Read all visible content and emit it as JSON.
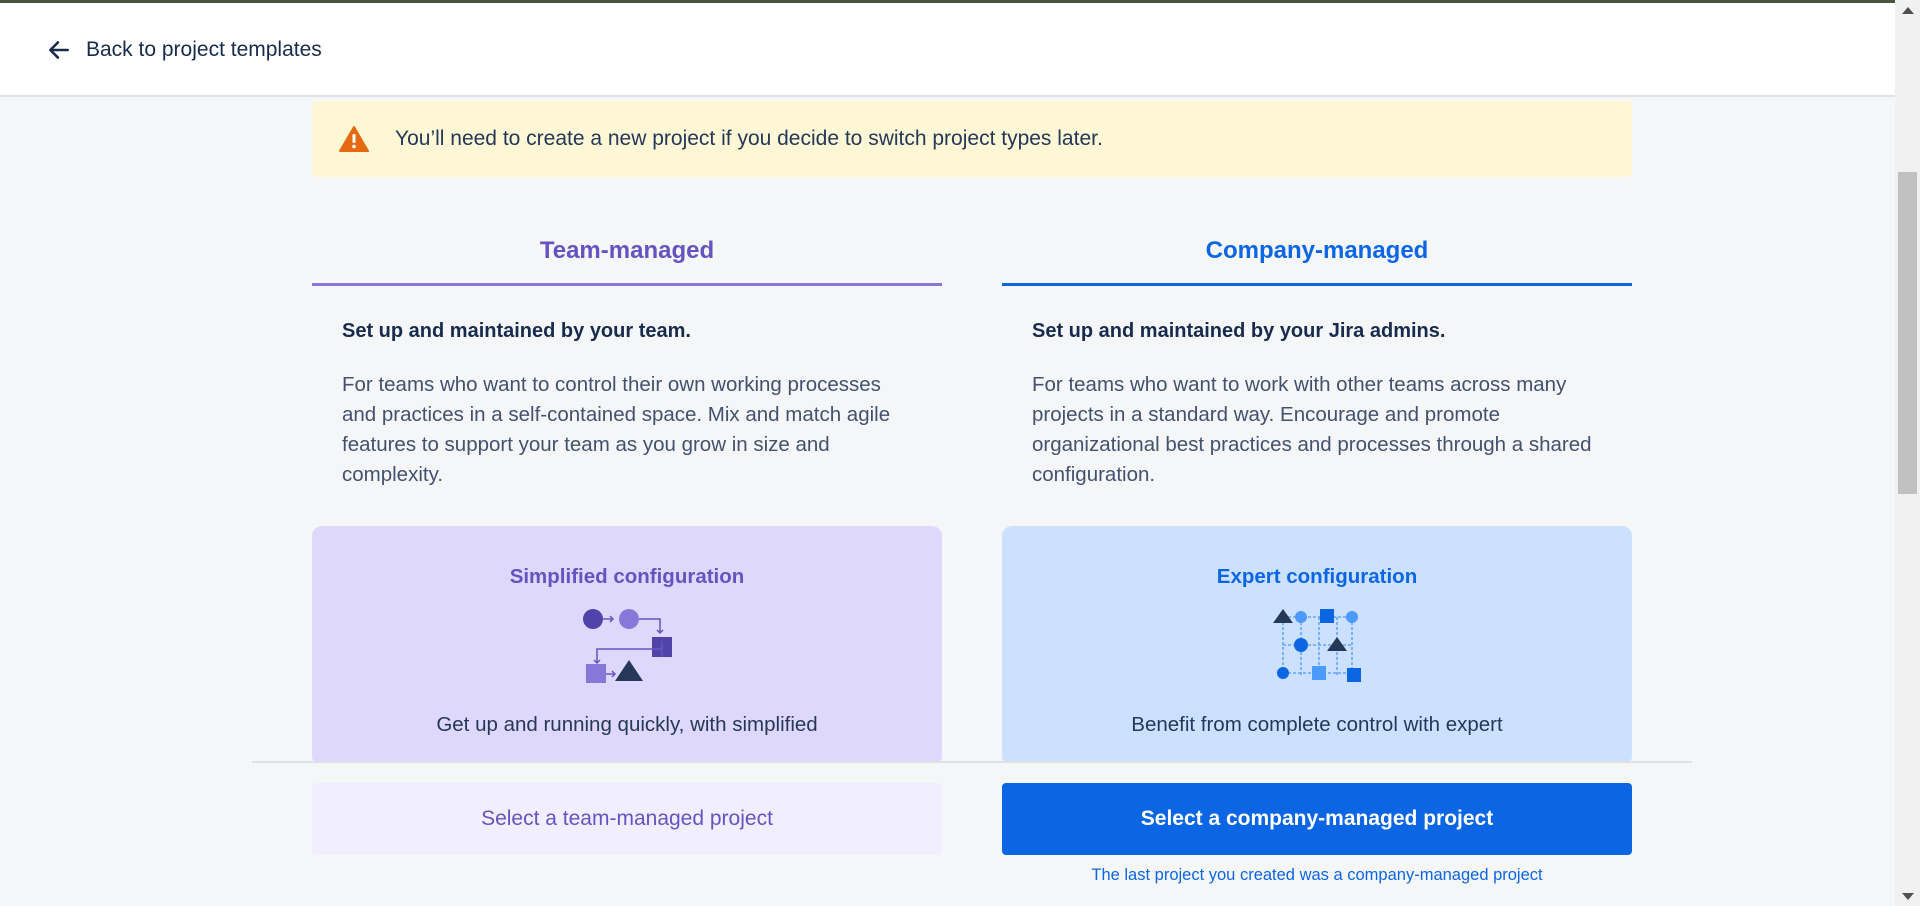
{
  "header": {
    "back_label": "Back to project templates"
  },
  "warning": {
    "text": "You’ll need to create a new project if you decide to switch project types later."
  },
  "team_managed": {
    "tab": "Team-managed",
    "subtitle": "Set up and maintained by your team.",
    "description": "For teams who want to control their own working processes and practices in a self-contained space. Mix and match agile features to support your team as you grow in size and complexity.",
    "card_title": "Simplified configuration",
    "card_text": "Get up and running quickly, with simplified",
    "button": "Select a team-managed project"
  },
  "company_managed": {
    "tab": "Company-managed",
    "subtitle": "Set up and maintained by your Jira admins.",
    "description": "For teams who want to work with other teams across many projects in a standard way. Encourage and promote organizational best practices and processes through a shared configuration.",
    "card_title": "Expert configuration",
    "card_text": "Benefit from complete control with expert",
    "button": "Select a company-managed project",
    "note": "The last project you created was a company-managed project"
  },
  "colors": {
    "team_accent": "#6554c0",
    "company_accent": "#0c66e4",
    "warning_bg": "#fef7d6",
    "warning_icon": "#e56910"
  },
  "icons": [
    "arrow-left-icon",
    "warning-icon",
    "simplified-config-icon",
    "expert-config-icon"
  ]
}
